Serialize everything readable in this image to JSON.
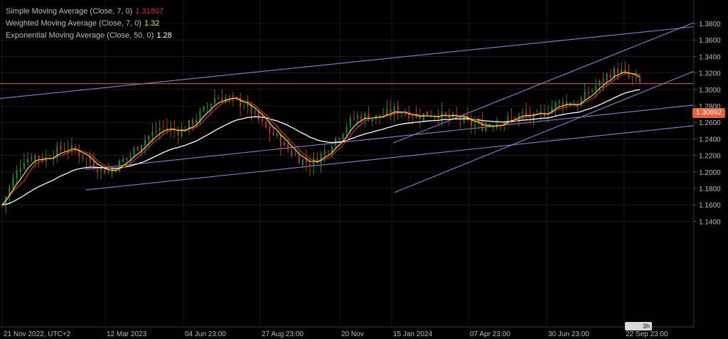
{
  "legend": {
    "sma": {
      "label": "Simple Moving Average (Close, 7, 0)",
      "value": "1.31807",
      "color": "#e02424"
    },
    "wma": {
      "label": "Weighted Moving Average (Close, 7, 0)",
      "value": "1.32",
      "color": "#e8e82a"
    },
    "ema": {
      "label": "Exponential Moving Average (Close, 50, 0)",
      "value": "1.28",
      "color": "#ffffff"
    }
  },
  "current_price": "1.30692",
  "timeframe": "3h",
  "colors": {
    "background": "#000000",
    "grid": "#2a2a2a",
    "up_candle": "#1f8a3a",
    "down_candle": "#b23a2a",
    "price_line": "#e8613b",
    "channel": "#8a7fd6"
  },
  "chart_data": {
    "type": "candlestick",
    "y_ticks": [
      "1.3800",
      "1.3600",
      "1.3400",
      "1.3200",
      "1.3000",
      "1.2800",
      "1.2600",
      "1.2400",
      "1.2200",
      "1.2000",
      "1.1800",
      "1.1600",
      "1.1400"
    ],
    "ylim": [
      1.136,
      1.386
    ],
    "x_ticks": [
      "21 Nov 2022, UTC+2",
      "12 Mar 2023",
      "04 Jun 23:00",
      "27 Aug 23:00",
      "20 Nov",
      "15 Jan 2024",
      "07 Apr 23:00",
      "30 Jun 23:00",
      "22 Sep 23:00"
    ],
    "close_path": [
      1.16,
      1.19,
      1.215,
      1.22,
      1.215,
      1.225,
      1.23,
      1.225,
      1.215,
      1.205,
      1.2,
      1.21,
      1.22,
      1.235,
      1.245,
      1.255,
      1.25,
      1.25,
      1.262,
      1.275,
      1.29,
      1.29,
      1.285,
      1.28,
      1.265,
      1.25,
      1.24,
      1.225,
      1.215,
      1.21,
      1.22,
      1.235,
      1.25,
      1.265,
      1.268,
      1.265,
      1.27,
      1.275,
      1.272,
      1.268,
      1.27,
      1.27,
      1.265,
      1.265,
      1.258,
      1.255,
      1.258,
      1.262,
      1.265,
      1.27,
      1.265,
      1.272,
      1.282,
      1.285,
      1.28,
      1.295,
      1.305,
      1.318,
      1.324,
      1.314,
      1.307
    ],
    "sma_last": 1.31807,
    "wma_last": 1.32,
    "ema_last": 1.28,
    "horizontal_line": 1.30692
  }
}
